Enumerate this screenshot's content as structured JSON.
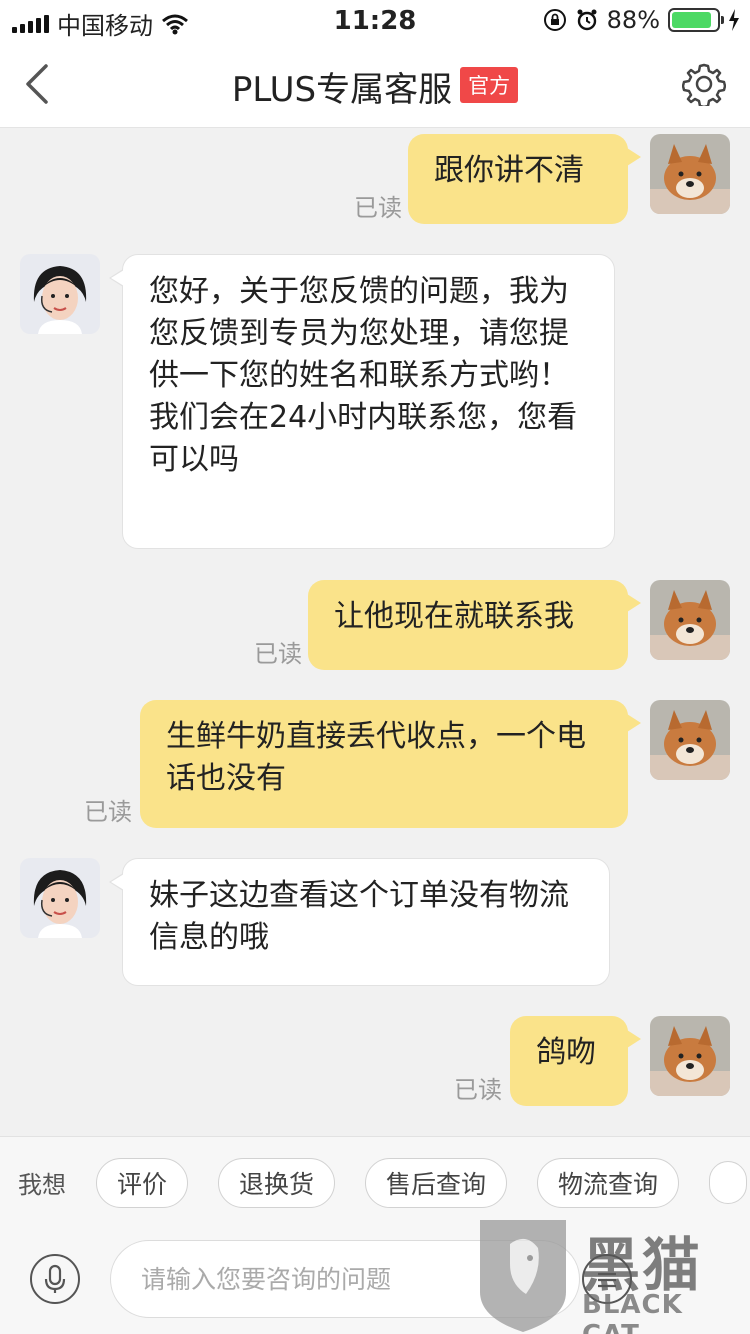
{
  "status_bar": {
    "carrier": "中国移动",
    "time": "11:28",
    "battery": "88%",
    "battery_level": 0.88
  },
  "header": {
    "title": "PLUS专属客服",
    "badge": "官方"
  },
  "messages": [
    {
      "side": "out",
      "text": "跟你讲不清",
      "status": "已读"
    },
    {
      "side": "in",
      "text": "您好，关于您反馈的问题，我为您反馈到专员为您处理，请您提供一下您的姓名和联系方式哟！我们会在24小时内联系您，您看可以吗"
    },
    {
      "side": "out",
      "text": "让他现在就联系我",
      "status": "已读"
    },
    {
      "side": "out",
      "text": "生鲜牛奶直接丢代收点，一个电话也没有",
      "status": "已读"
    },
    {
      "side": "in",
      "text": "妹子这边查看这个订单没有物流信息的哦"
    },
    {
      "side": "out",
      "text": "鸽吻",
      "status": "已读"
    }
  ],
  "quick_bar": {
    "label": "我想",
    "chips": [
      "评价",
      "退换货",
      "售后查询",
      "物流查询"
    ]
  },
  "input_bar": {
    "placeholder": "请输入您要咨询的问题"
  },
  "watermark": {
    "text_cn": "黑猫",
    "text_en": "BLACK CAT"
  },
  "colors": {
    "outgoing_bubble": "#fae38a",
    "incoming_bubble": "#ffffff",
    "badge": "#f04848",
    "background": "#f1f1f1"
  }
}
